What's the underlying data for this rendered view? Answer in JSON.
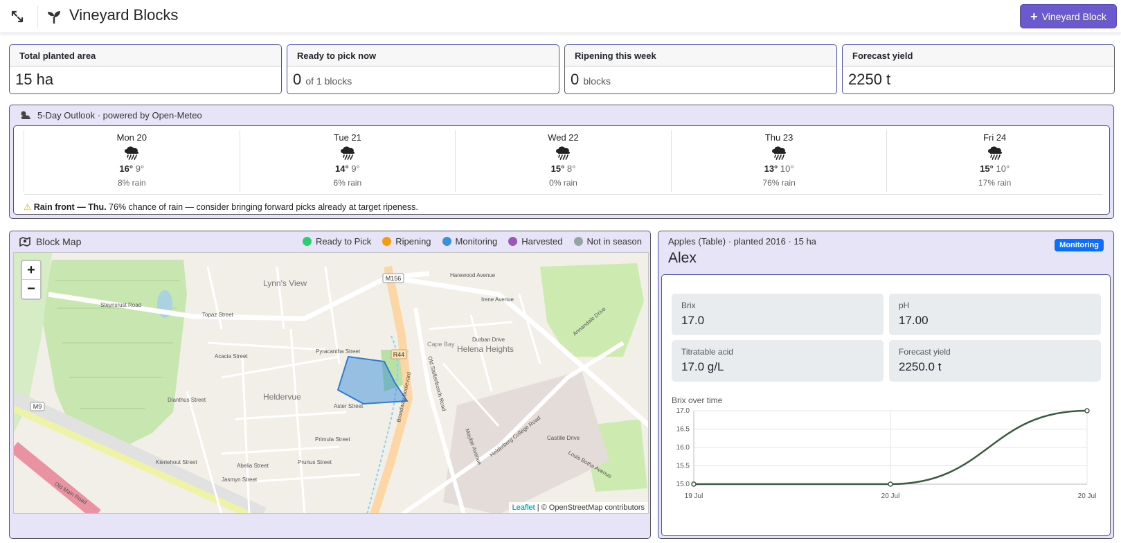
{
  "header": {
    "title": "Vineyard Blocks",
    "add_button_label": "Vineyard Block",
    "icons": [
      "expand-icon",
      "sprout-icon",
      "plus-icon"
    ]
  },
  "kpis": [
    {
      "label": "Total planted area",
      "value": "15 ha",
      "suffix": ""
    },
    {
      "label": "Ready to pick now",
      "value": "0",
      "suffix": "of 1 blocks"
    },
    {
      "label": "Ripening this week",
      "value": "0",
      "suffix": "blocks"
    },
    {
      "label": "Forecast yield",
      "value": "2250 t",
      "suffix": ""
    }
  ],
  "outlook": {
    "title": "5-Day Outlook · powered by Open-Meteo",
    "days": [
      {
        "name": "Mon 20",
        "high": "16°",
        "low": "9°",
        "rain": "8% rain"
      },
      {
        "name": "Tue 21",
        "high": "14°",
        "low": "9°",
        "rain": "6% rain"
      },
      {
        "name": "Wed 22",
        "high": "15°",
        "low": "8°",
        "rain": "0% rain"
      },
      {
        "name": "Thu 23",
        "high": "13°",
        "low": "10°",
        "rain": "76% rain"
      },
      {
        "name": "Fri 24",
        "high": "15°",
        "low": "10°",
        "rain": "17% rain"
      }
    ],
    "alert": {
      "lead": "Rain front — Thu.",
      "text": "76% chance of rain — consider bringing forward picks already at target ripeness."
    }
  },
  "map_panel": {
    "title": "Block Map",
    "legend": [
      {
        "label": "Ready to Pick",
        "color": "#2ecc71"
      },
      {
        "label": "Ripening",
        "color": "#f39c12"
      },
      {
        "label": "Monitoring",
        "color": "#3a8fd9"
      },
      {
        "label": "Harvested",
        "color": "#9b59b6"
      },
      {
        "label": "Not in season",
        "color": "#95a5a6"
      }
    ],
    "zoom_in": "+",
    "zoom_out": "−",
    "attribution_link": "Leaflet",
    "attribution_text": "| © OpenStreetMap contributors",
    "places": [
      "Lynn's View",
      "Helena Heights",
      "Heldervue",
      "Cape Bay"
    ],
    "streets": [
      "Steynsrust Road",
      "Irene Avenue",
      "Broadway Boulevard",
      "Old Stellenbosch Road",
      "Helderberg College Road",
      "Old Main Road",
      "Annandale Drive",
      "Harewood Avenue",
      "Topaz Street",
      "Acacia Street",
      "Primula Street",
      "Pyracantha Street",
      "Aster Street",
      "Abelia Street",
      "Prunus Street",
      "Jasmyn Street",
      "Kieriehout Street",
      "Castille Drive",
      "Louis Botha Avenue",
      "Durban Drive",
      "Mayfair Avenue",
      "Dianthus Street"
    ],
    "road_badges": [
      "M156",
      "R44",
      "M9"
    ]
  },
  "detail": {
    "subtitle": "Apples (Table) · planted 2016 · 15 ha",
    "badge": "Monitoring",
    "badge_color": "#0d6efd",
    "name": "Alex",
    "stats": [
      {
        "label": "Brix",
        "value": "17.0"
      },
      {
        "label": "pH",
        "value": "17.00"
      },
      {
        "label": "Titratable acid",
        "value": "17.0 g/L"
      },
      {
        "label": "Forecast yield",
        "value": "2250.0 t"
      }
    ],
    "chart_title": "Brix over time"
  },
  "chart_data": {
    "type": "line",
    "categories": [
      "19 Jul",
      "20 Jul",
      "20 Jul"
    ],
    "series": [
      {
        "values": [
          15.0,
          15.0,
          17.0
        ]
      }
    ],
    "y_ticks": [
      "17.0",
      "16.5",
      "16.0",
      "15.5",
      "15.0"
    ],
    "ylim": [
      15.0,
      17.0
    ],
    "grid": true,
    "color": "#3d5a40"
  }
}
